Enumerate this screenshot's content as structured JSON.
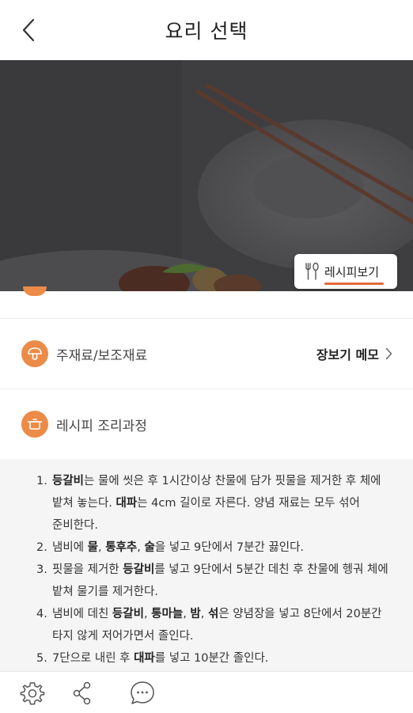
{
  "header": {
    "title": "요리 선택",
    "back_icon": "chevron-left-icon"
  },
  "hero": {
    "recipe_button_label": "레시피보기",
    "recipe_button_icon": "fork-spoon-icon"
  },
  "rows": [
    {
      "icon": "mushroom-icon",
      "label": "주재료/보조재료",
      "action": "장보기 메모"
    },
    {
      "icon": "pot-icon",
      "label": "레시피 조리과정"
    }
  ],
  "steps": [
    [
      [
        "b",
        "등갈비"
      ],
      [
        "t",
        "는 물에 씻은 후 1시간이상 찬물에 담가 핏물을 제거한 후 체에 밭쳐 놓는다. "
      ],
      [
        "b",
        "대파"
      ],
      [
        "t",
        "는 4cm 길이로 자른다. 양념 재료는 모두 섞어 준비한다."
      ]
    ],
    [
      [
        "t",
        "냄비에 "
      ],
      [
        "b",
        "물"
      ],
      [
        "t",
        ", "
      ],
      [
        "b",
        "통후추"
      ],
      [
        "t",
        ", "
      ],
      [
        "b",
        "술"
      ],
      [
        "t",
        "을 넣고 9단에서 7분간 끓인다."
      ]
    ],
    [
      [
        "t",
        "핏물을 제거한 "
      ],
      [
        "b",
        "등갈비"
      ],
      [
        "t",
        "를 넣고 9단에서 5분간 데친 후 찬물에 헹궈 체에 밭쳐 물기를 제거한다."
      ]
    ],
    [
      [
        "t",
        "냄비에 데친 "
      ],
      [
        "b",
        "등갈비"
      ],
      [
        "t",
        ", "
      ],
      [
        "b",
        "통마늘"
      ],
      [
        "t",
        ", "
      ],
      [
        "b",
        "밤"
      ],
      [
        "t",
        ", "
      ],
      [
        "b",
        "섞"
      ],
      [
        "t",
        "은 양념장을 넣고 8단에서 20분간 타지 않게 저어가면서 졸인다."
      ]
    ],
    [
      [
        "t",
        "7단으로 내린 후 "
      ],
      [
        "b",
        "대파"
      ],
      [
        "t",
        "를 넣고 10분간 졸인다."
      ]
    ]
  ],
  "bottom_bar": {
    "icons": [
      "gear-icon",
      "share-icon",
      "chat-icon"
    ]
  },
  "colors": {
    "accent": "#ec8b47",
    "underline": "#e46b3a",
    "steps_bg": "#f5f5f5"
  }
}
